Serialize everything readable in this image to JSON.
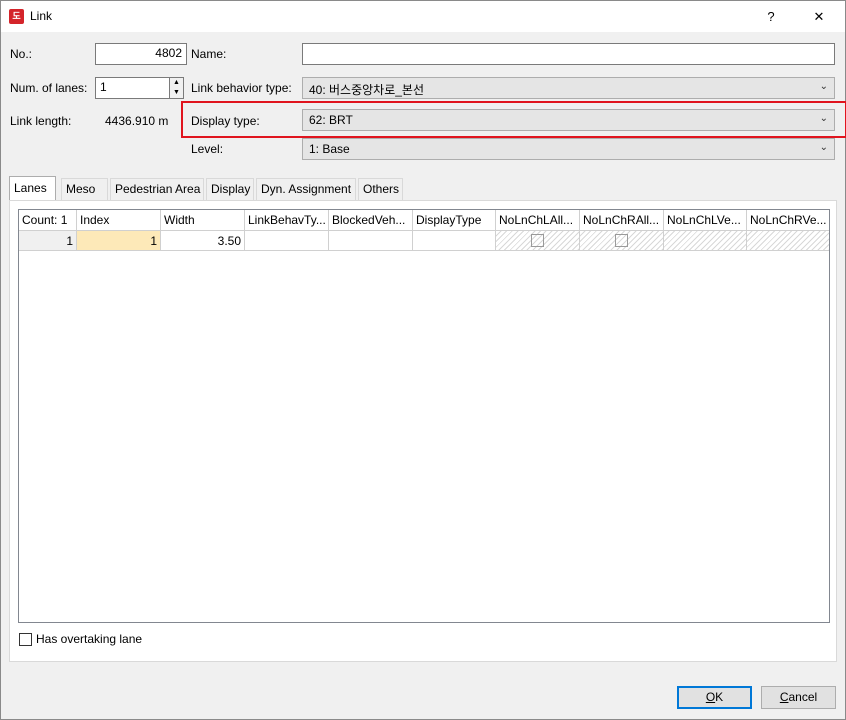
{
  "window": {
    "title": "Link",
    "help_button": "?",
    "close_button": "✕",
    "icon_text": "도"
  },
  "fields": {
    "no_label": "No.:",
    "no_value": "4802",
    "name_label": "Name:",
    "name_value": "",
    "lanes_label": "Num. of lanes:",
    "lanes_value": "1",
    "behavior_label": "Link behavior type:",
    "behavior_value": "40: 버스중앙차로_본선",
    "length_label": "Link length:",
    "length_value": "4436.910 m",
    "display_label": "Display type:",
    "display_value": "62: BRT",
    "level_label": "Level:",
    "level_value": "1: Base"
  },
  "tabs": [
    "Lanes",
    "Meso",
    "Pedestrian Area",
    "Display",
    "Dyn. Assignment",
    "Others"
  ],
  "grid": {
    "headers": [
      "Count: 1",
      "Index",
      "Width",
      "LinkBehavTy...",
      "BlockedVeh...",
      "DisplayType",
      "NoLnChLAll...",
      "NoLnChRAll...",
      "NoLnChLVe...",
      "NoLnChRVe..."
    ],
    "row": {
      "count": "1",
      "index": "1",
      "width": "3.50",
      "link_behav": "",
      "blocked_veh": "",
      "display_type": ""
    }
  },
  "has_overtaking": {
    "label": "Has overtaking lane",
    "checked": false
  },
  "buttons": {
    "ok_prefix": "",
    "ok_under": "O",
    "ok_rest": "K",
    "cancel_under": "C",
    "cancel_rest": "ancel"
  },
  "colors": {
    "highlight": "#e0141e",
    "selected_cell": "#fde9b8",
    "default_button": "#0078d7"
  }
}
